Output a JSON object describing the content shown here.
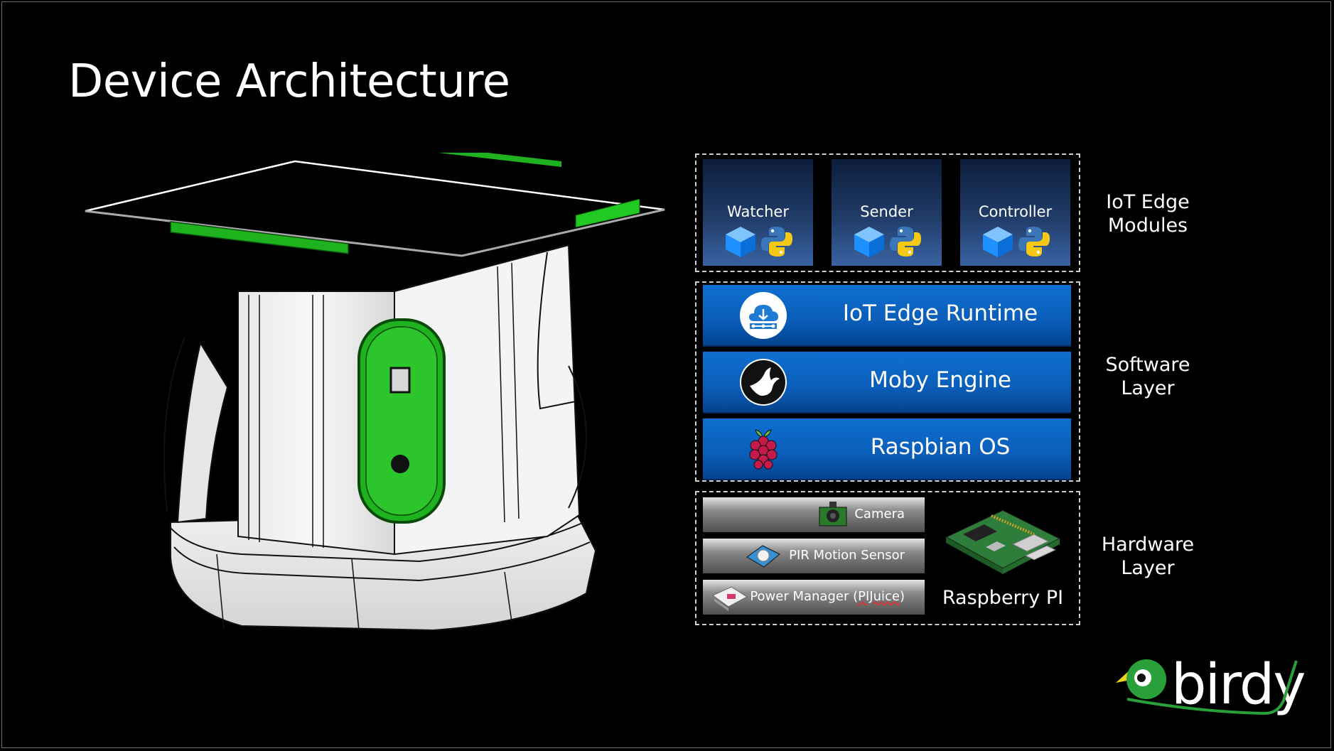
{
  "title": "Device Architecture",
  "modules": [
    {
      "label": "Watcher",
      "icons": [
        "azure-cube-icon",
        "python-icon"
      ]
    },
    {
      "label": "Sender",
      "icons": [
        "azure-cube-icon",
        "python-icon"
      ]
    },
    {
      "label": "Controller",
      "icons": [
        "azure-cube-icon",
        "python-icon"
      ]
    }
  ],
  "software": [
    {
      "label": "IoT Edge Runtime",
      "icon": "iot-edge-icon"
    },
    {
      "label": "Moby Engine",
      "icon": "moby-icon"
    },
    {
      "label": "Raspbian OS",
      "icon": "raspberry-pi-icon"
    }
  ],
  "hardware": {
    "items": [
      {
        "label": "Camera",
        "icon": "camera-module-icon"
      },
      {
        "label": "PIR Motion Sensor",
        "icon": "pir-sensor-icon"
      },
      {
        "label_prefix": "Power Manager (",
        "label_highlight": "PIJuice",
        "label_suffix": ")",
        "icon": "power-board-icon"
      }
    ],
    "board_label": "Raspberry PI"
  },
  "layers": {
    "modules": [
      "IoT Edge",
      "Modules"
    ],
    "software": [
      "Software",
      "Layer"
    ],
    "hardware": [
      "Hardware",
      "Layer"
    ]
  },
  "logo": {
    "text": "birdy"
  },
  "colors": {
    "background": "#000000",
    "software_bar": "#0a5db8",
    "module_box": "#203c68",
    "accent_green": "#1fb21f",
    "logo_green": "#29a03a",
    "logo_yellow": "#e8d21c"
  }
}
